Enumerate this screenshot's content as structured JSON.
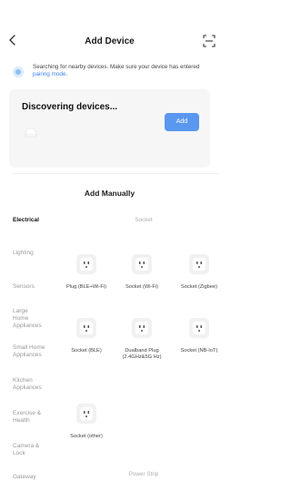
{
  "header": {
    "title": "Add Device",
    "back_icon": "chevron-left-icon",
    "scan_icon": "scan-icon"
  },
  "notice": {
    "text": "Searching for nearby devices. Make sure your device has entered ",
    "link": "pairing mode",
    "suffix": "."
  },
  "discover": {
    "title": "Discovering devices...",
    "add_label": "Add"
  },
  "manual": {
    "title": "Add Manually"
  },
  "sidebar": {
    "items": [
      {
        "label": "Electrical",
        "active": true
      },
      {
        "label": "Lighting"
      },
      {
        "label": "Sensors"
      },
      {
        "label": "Large Home Appliances"
      },
      {
        "label": "Small Home Appliances"
      },
      {
        "label": "Kitchen Appliances"
      },
      {
        "label": "Exercise & Health"
      },
      {
        "label": "Camera & Lock"
      },
      {
        "label": "Gateway"
      }
    ]
  },
  "content": {
    "category": "Socket",
    "next_category": "Power Strip",
    "devices": [
      {
        "name": "Plug (BLE+Wi-Fi)"
      },
      {
        "name": "Socket (Wi-Fi)"
      },
      {
        "name": "Socket (Zigbee)"
      },
      {
        "name": "Socket (BLE)"
      },
      {
        "name": "Dualband Plug (2.4GHz&5G Hz)"
      },
      {
        "name": "Socket (NB-IoT)"
      },
      {
        "name": "Socket (other)"
      }
    ]
  },
  "colors": {
    "accent": "#5a97ef",
    "link": "#3b82f6"
  }
}
